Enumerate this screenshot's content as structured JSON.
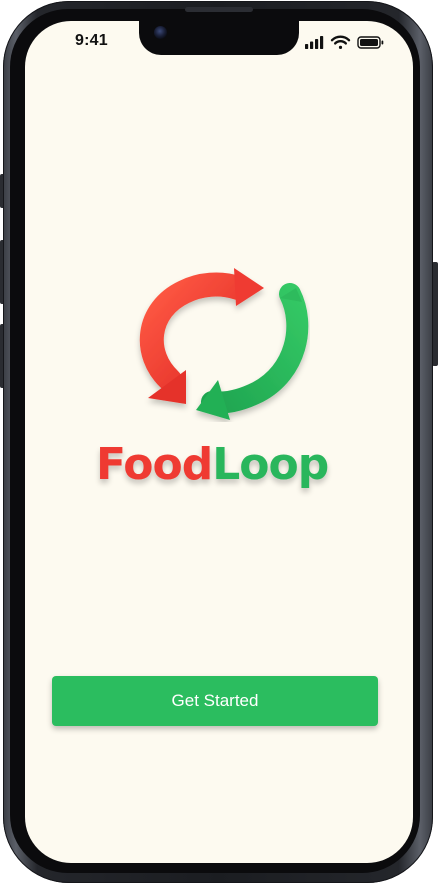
{
  "status_bar": {
    "time": "9:41",
    "signal_icon": "cellular-signal-icon",
    "wifi_icon": "wifi-icon",
    "battery_icon": "battery-icon"
  },
  "brand": {
    "logo_icon": "recycle-arrows-icon",
    "name_part_1": "Food",
    "name_part_2": "Loop",
    "colors": {
      "red": "#ef3a32",
      "green": "#29b65c",
      "background": "#fdfaf0"
    }
  },
  "actions": {
    "get_started_label": "Get Started",
    "button_color": "#2bbd5f"
  }
}
